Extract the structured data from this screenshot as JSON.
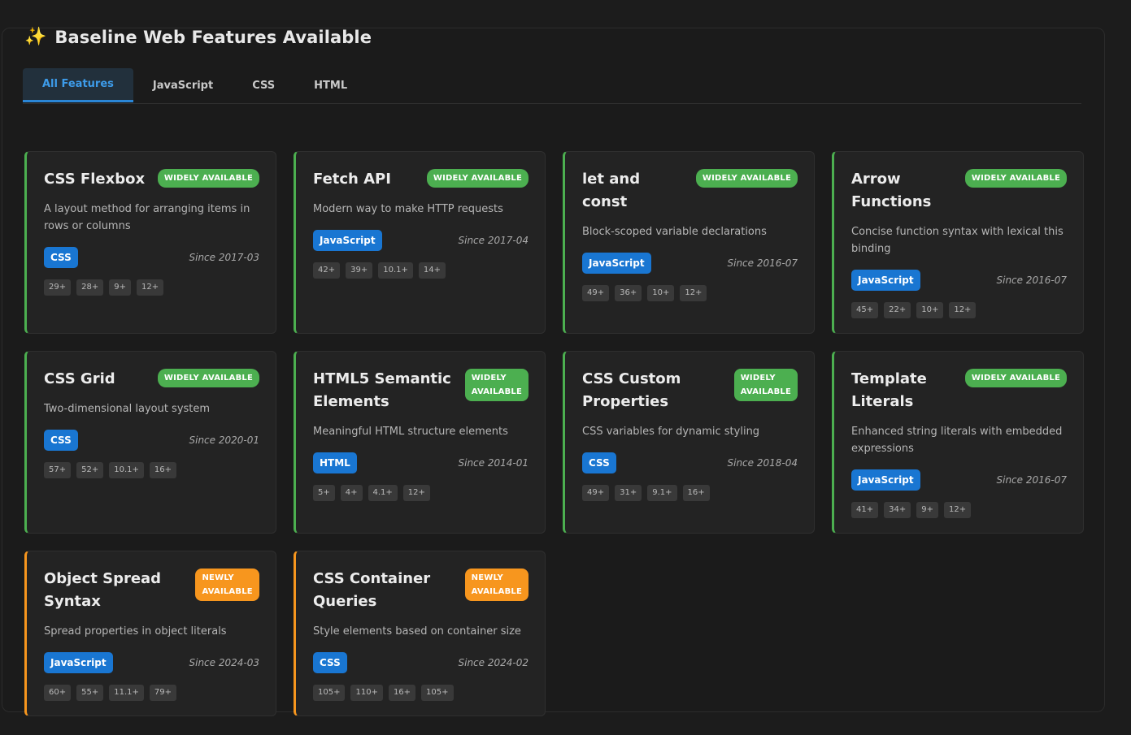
{
  "header": {
    "icon": "sparkles-icon",
    "title": "Baseline Web Features Available"
  },
  "tabs": [
    {
      "label": "All Features",
      "active": true
    },
    {
      "label": "JavaScript",
      "active": false
    },
    {
      "label": "CSS",
      "active": false
    },
    {
      "label": "HTML",
      "active": false
    }
  ],
  "colors": {
    "widely": "#4caf50",
    "newly": "#f7961e",
    "category": "#1976d2",
    "tab_active": "#3d9be9"
  },
  "features": [
    {
      "name": "CSS Flexbox",
      "status": "WIDELY AVAILABLE",
      "status_type": "widely",
      "description": "A layout method for arranging items in rows or columns",
      "category": "CSS",
      "since": "Since 2017-03",
      "versions": [
        "29+",
        "28+",
        "9+",
        "12+"
      ]
    },
    {
      "name": "Fetch API",
      "status": "WIDELY AVAILABLE",
      "status_type": "widely",
      "description": "Modern way to make HTTP requests",
      "category": "JavaScript",
      "since": "Since 2017-04",
      "versions": [
        "42+",
        "39+",
        "10.1+",
        "14+"
      ]
    },
    {
      "name": "let and const",
      "status": "WIDELY AVAILABLE",
      "status_type": "widely",
      "description": "Block-scoped variable declarations",
      "category": "JavaScript",
      "since": "Since 2016-07",
      "versions": [
        "49+",
        "36+",
        "10+",
        "12+"
      ]
    },
    {
      "name": "Arrow Functions",
      "status": "WIDELY AVAILABLE",
      "status_type": "widely",
      "description": "Concise function syntax with lexical this binding",
      "category": "JavaScript",
      "since": "Since 2016-07",
      "versions": [
        "45+",
        "22+",
        "10+",
        "12+"
      ]
    },
    {
      "name": "CSS Grid",
      "status": "WIDELY AVAILABLE",
      "status_type": "widely",
      "description": "Two-dimensional layout system",
      "category": "CSS",
      "since": "Since 2020-01",
      "versions": [
        "57+",
        "52+",
        "10.1+",
        "16+"
      ]
    },
    {
      "name": "HTML5 Semantic Elements",
      "status": "WIDELY AVAILABLE",
      "status_type": "widely",
      "description": "Meaningful HTML structure elements",
      "category": "HTML",
      "since": "Since 2014-01",
      "versions": [
        "5+",
        "4+",
        "4.1+",
        "12+"
      ]
    },
    {
      "name": "CSS Custom Properties",
      "status": "WIDELY AVAILABLE",
      "status_type": "widely",
      "description": "CSS variables for dynamic styling",
      "category": "CSS",
      "since": "Since 2018-04",
      "versions": [
        "49+",
        "31+",
        "9.1+",
        "16+"
      ]
    },
    {
      "name": "Template Literals",
      "status": "WIDELY AVAILABLE",
      "status_type": "widely",
      "description": "Enhanced string literals with embedded expressions",
      "category": "JavaScript",
      "since": "Since 2016-07",
      "versions": [
        "41+",
        "34+",
        "9+",
        "12+"
      ]
    },
    {
      "name": "Object Spread Syntax",
      "status": "NEWLY AVAILABLE",
      "status_type": "newly",
      "description": "Spread properties in object literals",
      "category": "JavaScript",
      "since": "Since 2024-03",
      "versions": [
        "60+",
        "55+",
        "11.1+",
        "79+"
      ]
    },
    {
      "name": "CSS Container Queries",
      "status": "NEWLY AVAILABLE",
      "status_type": "newly",
      "description": "Style elements based on container size",
      "category": "CSS",
      "since": "Since 2024-02",
      "versions": [
        "105+",
        "110+",
        "16+",
        "105+"
      ]
    }
  ]
}
